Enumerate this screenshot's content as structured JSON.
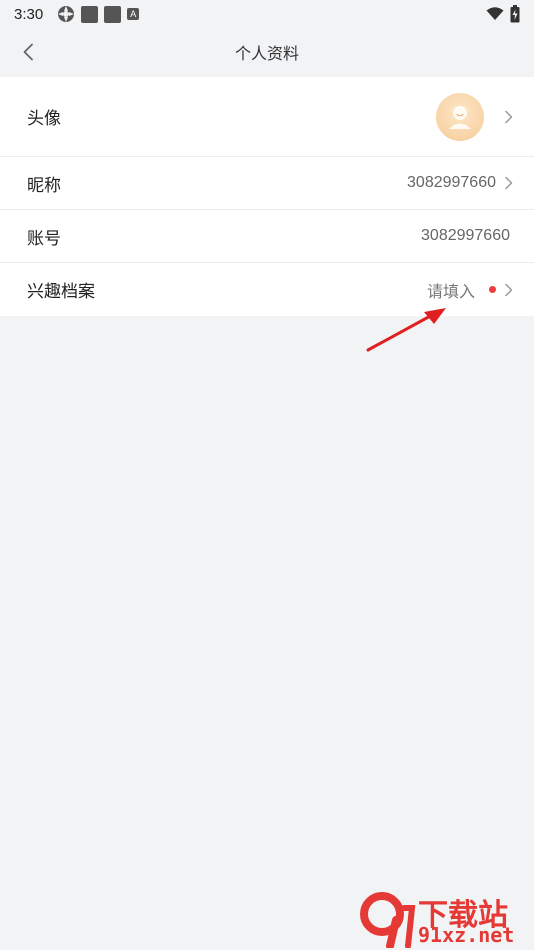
{
  "status_bar": {
    "time": "3:30",
    "notification_badge": "A",
    "icons": [
      "gear-icon",
      "notification-square-icon",
      "notification-square-icon",
      "a-badge-icon",
      "wifi-icon",
      "battery-icon"
    ]
  },
  "nav": {
    "title": "个人资料",
    "back_icon": "chevron-left-icon"
  },
  "profile": {
    "rows": [
      {
        "label": "头像",
        "value": "",
        "type": "avatar"
      },
      {
        "label": "昵称",
        "value": "3082997660"
      },
      {
        "label": "账号",
        "value": "3082997660"
      },
      {
        "label": "兴趣档案",
        "value": "请填入"
      }
    ]
  },
  "watermark": {
    "line1": "下载站",
    "line2": "91xz.net",
    "logo_glyph": "9"
  },
  "colors": {
    "background": "#f2f3f5",
    "card": "#ffffff",
    "accent_red": "#f23b3b",
    "arrow_red": "#e02020",
    "avatar_tint": "#f8d3a6"
  }
}
